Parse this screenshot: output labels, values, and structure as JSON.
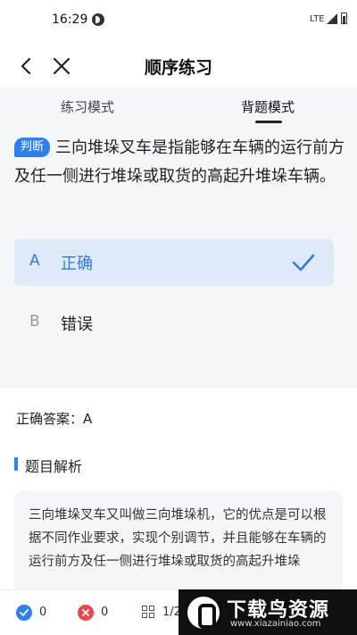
{
  "status_bar": {
    "time": "16:29",
    "network": "LTE"
  },
  "nav": {
    "title": "顺序练习"
  },
  "tabs": [
    {
      "label": "练习模式",
      "active": false
    },
    {
      "label": "背题模式",
      "active": true
    }
  ],
  "question": {
    "type_badge": "判断",
    "text": "三向堆垛叉车是指能够在车辆的运行前方及任一侧进行堆垛或取货的高起升堆垛车辆。"
  },
  "options": [
    {
      "letter": "A",
      "text": "正确",
      "selected": true
    },
    {
      "letter": "B",
      "text": "错误",
      "selected": false
    }
  ],
  "answer": {
    "label": "正确答案：A"
  },
  "analysis": {
    "title": "题目解析",
    "text": "三向堆垛叉车又叫做三向堆垛机，它的优点是可以根据不同作业要求，实现个别调节，并且能够在车辆的运行前方及任一侧进行堆垛或取货的高起升堆垛"
  },
  "bottom_bar": {
    "correct_count": "0",
    "wrong_count": "0",
    "progress": "1/2"
  },
  "watermark": {
    "title": "下载鸟资源",
    "url": "www.xiazainiao.com"
  },
  "colors": {
    "accent": "#2f80ed",
    "wrong": "#e5484d",
    "selected_bg": "#dfeaf9"
  }
}
